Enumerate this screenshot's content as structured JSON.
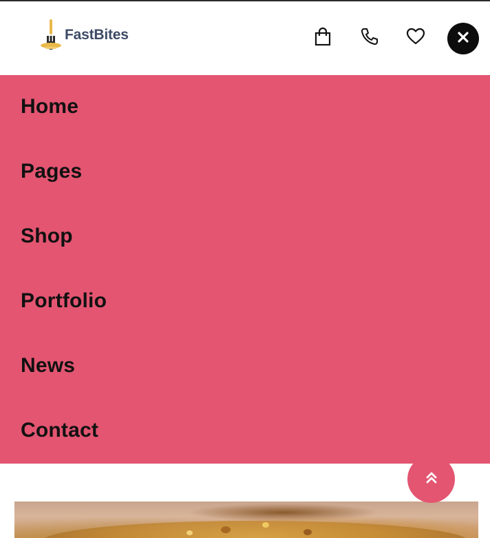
{
  "brand": {
    "name": "FastBites",
    "logo_icon": "fork-plate-icon",
    "logo_color": "#e9b94a",
    "text_color": "#3d4a66"
  },
  "header": {
    "icons": [
      "shopping-bag-icon",
      "phone-icon",
      "heart-icon"
    ],
    "close_icon": "close-icon"
  },
  "menu": {
    "background": "#e35571",
    "items": [
      {
        "label": "Home"
      },
      {
        "label": "Pages"
      },
      {
        "label": "Shop"
      },
      {
        "label": "Portfolio"
      },
      {
        "label": "News"
      },
      {
        "label": "Contact"
      }
    ]
  },
  "scroll_top": {
    "icon": "double-chevron-up-icon",
    "color": "#e35571"
  }
}
